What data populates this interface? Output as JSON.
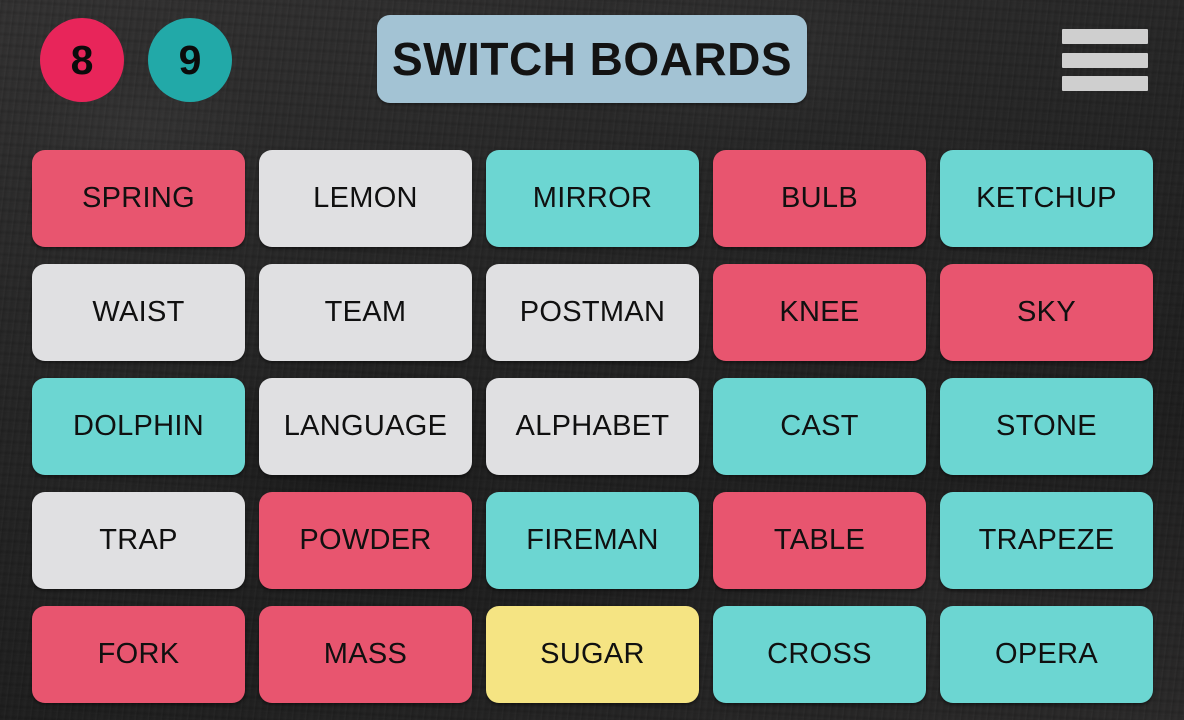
{
  "app": {
    "title": "SWITCH BOARDS",
    "background_color": "#282828"
  },
  "header": {
    "scores": [
      {
        "name": "score-pink",
        "value": "8",
        "color": "#e8255a"
      },
      {
        "name": "score-teal",
        "value": "9",
        "color": "#22a9a8"
      }
    ],
    "title": "SWITCH BOARDS",
    "title_bg_color": "#a3c3d4",
    "menu_icon": "hamburger-menu-icon",
    "menu_bar_color": "#cfcfcf"
  },
  "palette": {
    "pink": "#e8556f",
    "grey": "#e0e0e2",
    "teal": "#6cd6d2",
    "yellow": "#f5e483",
    "tile_text": "#101010"
  },
  "board": {
    "columns": 5,
    "rows": 5,
    "tiles": [
      {
        "label": "SPRING",
        "color": "pink"
      },
      {
        "label": "LEMON",
        "color": "grey"
      },
      {
        "label": "MIRROR",
        "color": "teal"
      },
      {
        "label": "BULB",
        "color": "pink"
      },
      {
        "label": "KETCHUP",
        "color": "teal"
      },
      {
        "label": "WAIST",
        "color": "grey"
      },
      {
        "label": "TEAM",
        "color": "grey"
      },
      {
        "label": "POSTMAN",
        "color": "grey"
      },
      {
        "label": "KNEE",
        "color": "pink"
      },
      {
        "label": "SKY",
        "color": "pink"
      },
      {
        "label": "DOLPHIN",
        "color": "teal"
      },
      {
        "label": "LANGUAGE",
        "color": "grey"
      },
      {
        "label": "ALPHABET",
        "color": "grey"
      },
      {
        "label": "CAST",
        "color": "teal"
      },
      {
        "label": "STONE",
        "color": "teal"
      },
      {
        "label": "TRAP",
        "color": "grey"
      },
      {
        "label": "POWDER",
        "color": "pink"
      },
      {
        "label": "FIREMAN",
        "color": "teal"
      },
      {
        "label": "TABLE",
        "color": "pink"
      },
      {
        "label": "TRAPEZE",
        "color": "teal"
      },
      {
        "label": "FORK",
        "color": "pink"
      },
      {
        "label": "MASS",
        "color": "pink"
      },
      {
        "label": "SUGAR",
        "color": "yellow"
      },
      {
        "label": "CROSS",
        "color": "teal"
      },
      {
        "label": "OPERA",
        "color": "teal"
      }
    ]
  }
}
